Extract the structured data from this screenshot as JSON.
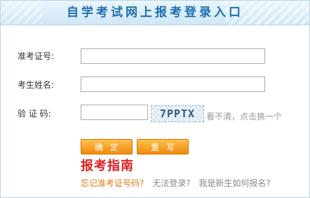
{
  "header": {
    "title": "自学考试网上报考登录入口"
  },
  "form": {
    "ticket_label": "准考证号:",
    "ticket_value": "",
    "name_label": "考生姓名:",
    "name_value": "",
    "captcha_label": "验 证 码:",
    "captcha_value": "",
    "captcha_code": "7PPTX",
    "captcha_hint": "看不清，点击换一个"
  },
  "buttons": {
    "confirm_label": "确定",
    "reset_label": "重写"
  },
  "guide": {
    "text": "报考指南"
  },
  "links": {
    "forgot_ticket": "忘记准考证号码?",
    "cannot_login": "无法登录?",
    "new_student": "我是新生如何报名?"
  },
  "colors": {
    "title": "#1f6fb2",
    "button": "#f08a10",
    "guide": "#e02020",
    "link_orange": "#e07a1a",
    "link_gray": "#8a8a8a"
  }
}
